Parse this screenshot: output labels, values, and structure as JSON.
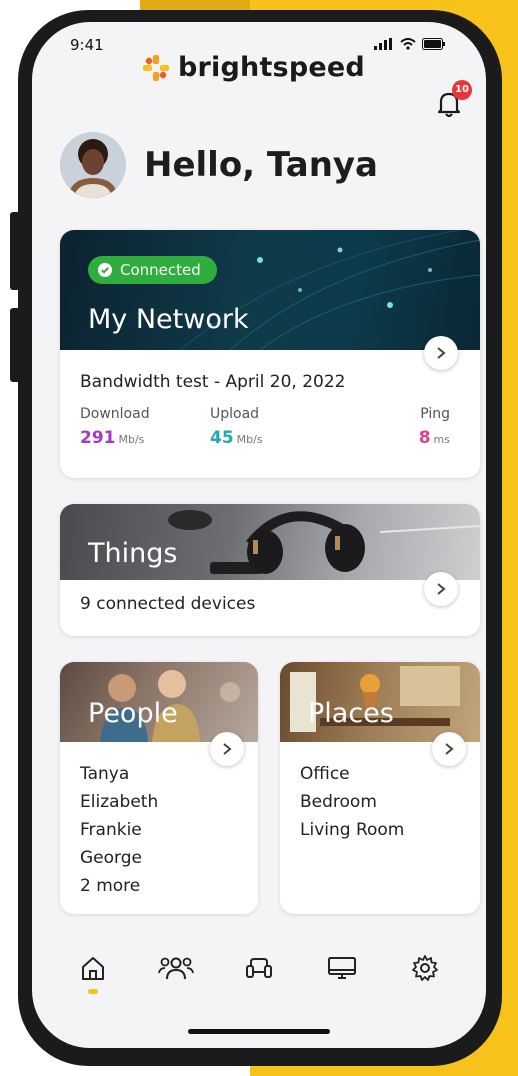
{
  "status_bar": {
    "time": "9:41"
  },
  "brand": {
    "name": "brightspeed",
    "accent_color": "#f7c31b",
    "icon": "brightspeed-logo-icon"
  },
  "notifications": {
    "icon": "bell-icon",
    "badge_count": "10",
    "badge_color": "#e8343b"
  },
  "greeting": {
    "text": "Hello, Tanya",
    "avatar": "user-avatar"
  },
  "network_card": {
    "status": "Connected",
    "status_color": "#2fae3e",
    "title": "My Network",
    "bandwidth_title": "Bandwidth test - April 20, 2022",
    "metrics": [
      {
        "label": "Download",
        "value": "291",
        "unit": "Mb/s",
        "color": "#a13cc9"
      },
      {
        "label": "Upload",
        "value": "45",
        "unit": "Mb/s",
        "color": "#1fa7b7"
      },
      {
        "label": "Ping",
        "value": "8",
        "unit": "ms",
        "color": "#e0408a"
      }
    ]
  },
  "things_card": {
    "title": "Things",
    "subtitle": "9 connected devices"
  },
  "people_card": {
    "title": "People",
    "items": [
      "Tanya",
      "Elizabeth",
      "Frankie",
      "George",
      "2 more"
    ]
  },
  "places_card": {
    "title": "Places",
    "items": [
      "Office",
      "Bedroom",
      "Living Room"
    ]
  },
  "bottom_nav": {
    "items": [
      {
        "name": "home",
        "icon": "home-icon",
        "active": true
      },
      {
        "name": "people",
        "icon": "people-icon",
        "active": false
      },
      {
        "name": "things",
        "icon": "couch-icon",
        "active": false
      },
      {
        "name": "places",
        "icon": "monitor-icon",
        "active": false
      },
      {
        "name": "settings",
        "icon": "gear-icon",
        "active": false
      }
    ]
  }
}
